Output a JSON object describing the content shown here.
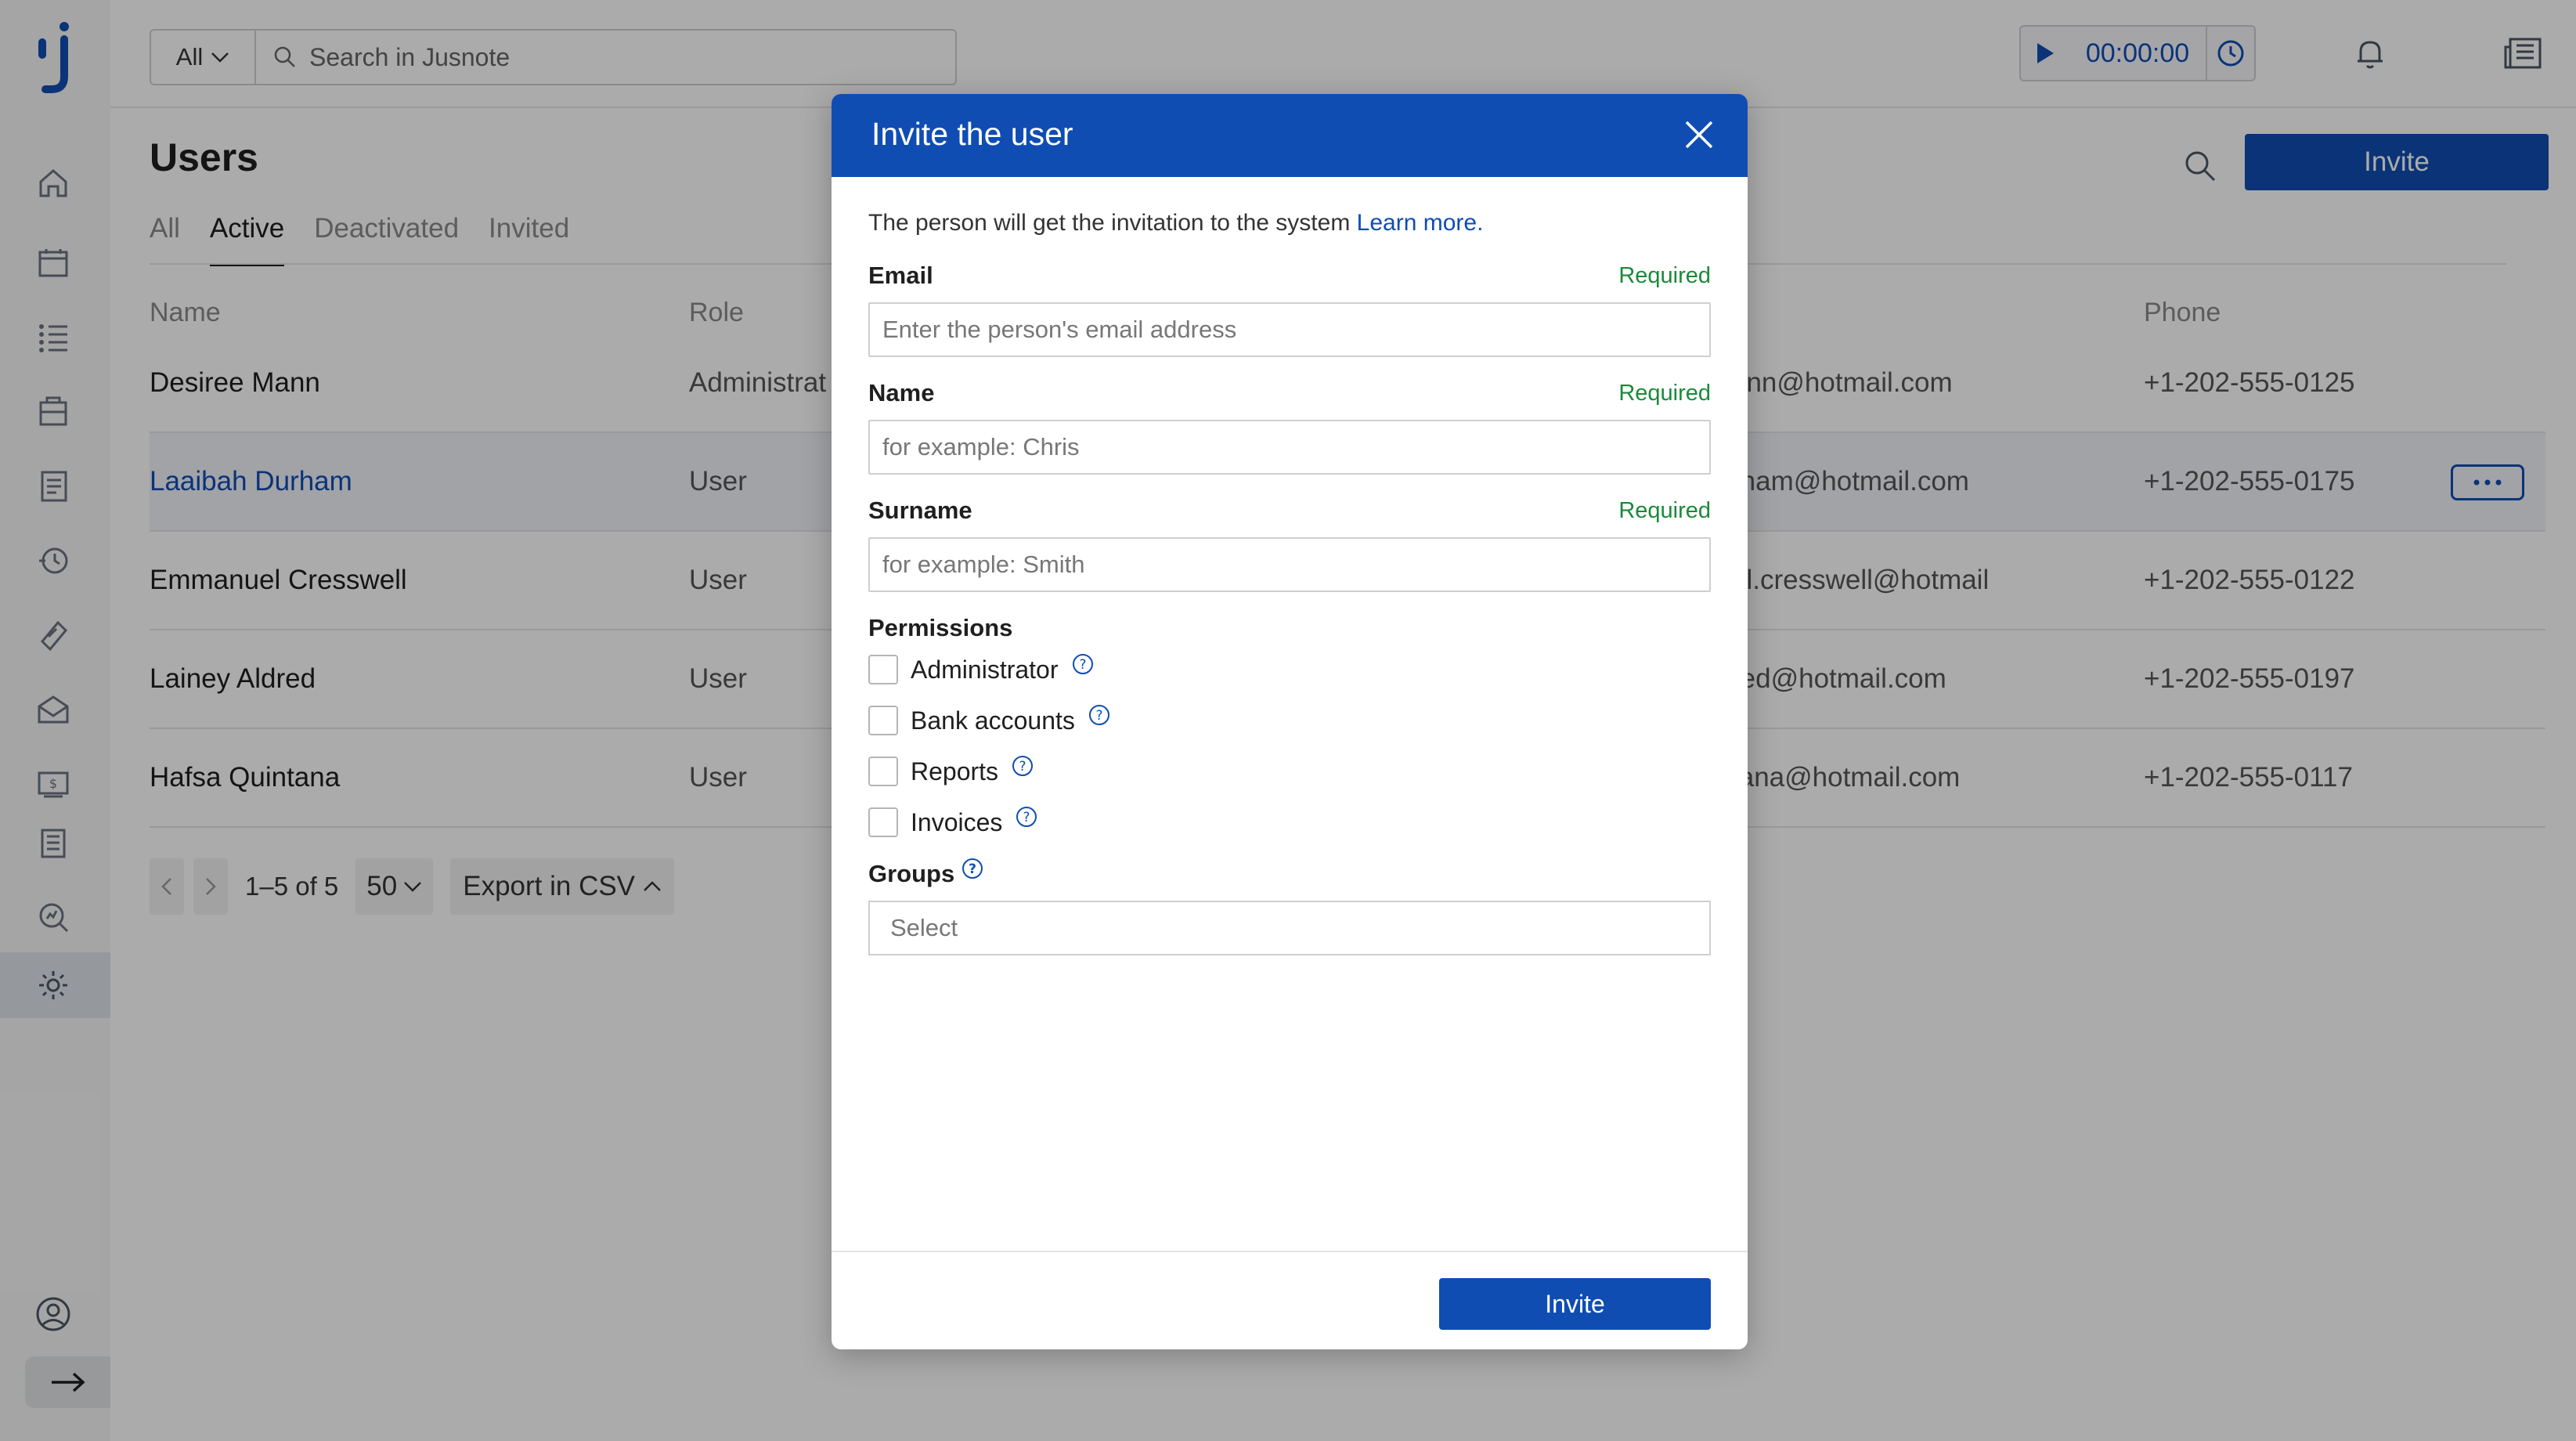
{
  "app": {
    "logo_text": "ĵ"
  },
  "search": {
    "scope": "All",
    "placeholder": "Search in Jusnote"
  },
  "timer": {
    "value": "00:00:00"
  },
  "page": {
    "title": "Users",
    "tabs": [
      "All",
      "Active",
      "Deactivated",
      "Invited"
    ],
    "active_tab": "Active",
    "invite_label": "Invite"
  },
  "table": {
    "headers": {
      "name": "Name",
      "role": "Role",
      "phone": "Phone"
    },
    "rows": [
      {
        "name": "Desiree Mann",
        "role": "Administrat",
        "email": "ann@hotmail.com",
        "phone": "+1-202-555-0125"
      },
      {
        "name": "Laaibah Durham",
        "role": "User",
        "email": "rham@hotmail.com",
        "phone": "+1-202-555-0175"
      },
      {
        "name": "Emmanuel Cresswell",
        "role": "User",
        "email": "el.cresswell@hotmail",
        "phone": "+1-202-555-0122"
      },
      {
        "name": "Lainey Aldred",
        "role": "User",
        "email": "red@hotmail.com",
        "phone": "+1-202-555-0197"
      },
      {
        "name": "Hafsa Quintana",
        "role": "User",
        "email": "tana@hotmail.com",
        "phone": "+1-202-555-0117"
      }
    ]
  },
  "pager": {
    "range": "1–5 of 5",
    "page_size": "50",
    "export_label": "Export in CSV"
  },
  "modal": {
    "title": "Invite the user",
    "intro": "The person will get the invitation to the system",
    "learn_more": "Learn more.",
    "email": {
      "label": "Email",
      "required": "Required",
      "placeholder": "Enter the person's email address"
    },
    "name": {
      "label": "Name",
      "required": "Required",
      "placeholder": "for example: Chris"
    },
    "surname": {
      "label": "Surname",
      "required": "Required",
      "placeholder": "for example: Smith"
    },
    "permissions": {
      "label": "Permissions",
      "items": [
        "Administrator",
        "Bank accounts",
        "Reports",
        "Invoices"
      ]
    },
    "groups": {
      "label": "Groups",
      "placeholder": "Select"
    },
    "invite_label": "Invite"
  },
  "colors": {
    "brand_blue": "#0f4db3",
    "add_green": "#1a9a55",
    "required_green": "#1a8a3a"
  }
}
